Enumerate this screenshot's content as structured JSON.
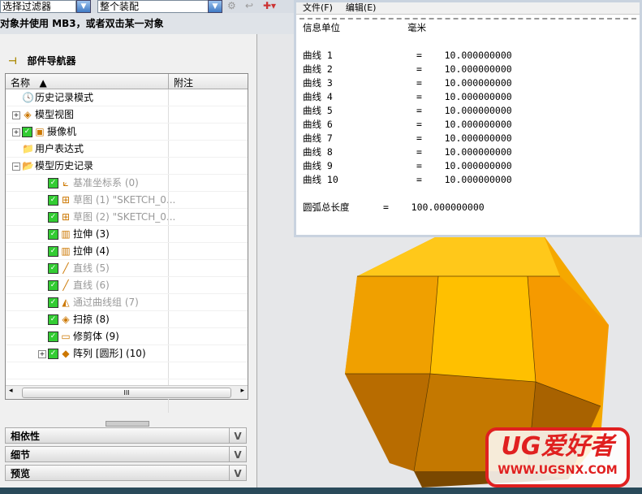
{
  "toolbar": {
    "filter": "选择过滤器",
    "scope": "整个装配"
  },
  "cue": "对象并使用 MB3，或者双击某一对象",
  "navigator": {
    "title": "部件导航器",
    "col_name": "名称",
    "col_note": "附注",
    "items": [
      {
        "label": "历史记录模式",
        "icon": "clock-icon",
        "gray": false,
        "check": false,
        "expand": ""
      },
      {
        "label": "模型视图",
        "icon": "model-views-icon",
        "gray": false,
        "check": false,
        "expand": "+"
      },
      {
        "label": "摄像机",
        "icon": "camera-icon",
        "gray": false,
        "check": true,
        "expand": "+"
      },
      {
        "label": "用户表达式",
        "icon": "folder-icon",
        "gray": false,
        "check": false,
        "expand": ""
      },
      {
        "label": "模型历史记录",
        "icon": "folder-open-icon",
        "gray": false,
        "check": false,
        "expand": "-"
      },
      {
        "label": "基准坐标系 (0)",
        "icon": "datum-csys-icon",
        "gray": true,
        "check": true,
        "expand": ""
      },
      {
        "label": "草图 (1) \"SKETCH_0...",
        "icon": "sketch-icon",
        "gray": true,
        "check": true,
        "expand": ""
      },
      {
        "label": "草图 (2) \"SKETCH_0...",
        "icon": "sketch-icon",
        "gray": true,
        "check": true,
        "expand": ""
      },
      {
        "label": "拉伸 (3)",
        "icon": "extrude-icon",
        "gray": false,
        "check": true,
        "expand": ""
      },
      {
        "label": "拉伸 (4)",
        "icon": "extrude-icon",
        "gray": false,
        "check": true,
        "expand": ""
      },
      {
        "label": "直线 (5)",
        "icon": "line-icon",
        "gray": true,
        "check": true,
        "expand": ""
      },
      {
        "label": "直线 (6)",
        "icon": "line-icon",
        "gray": true,
        "check": true,
        "expand": ""
      },
      {
        "label": "通过曲线组 (7)",
        "icon": "through-curves-icon",
        "gray": true,
        "check": true,
        "expand": ""
      },
      {
        "label": "扫掠 (8)",
        "icon": "swept-icon",
        "gray": false,
        "check": true,
        "expand": ""
      },
      {
        "label": "修剪体 (9)",
        "icon": "trim-body-icon",
        "gray": false,
        "check": true,
        "expand": ""
      },
      {
        "label": "阵列 [圆形] (10)",
        "icon": "pattern-icon",
        "gray": false,
        "check": true,
        "expand": "+"
      }
    ]
  },
  "panels": [
    "相依性",
    "细节",
    "预览"
  ],
  "info": {
    "menu": [
      "文件(F)",
      "编辑(E)"
    ],
    "unit_label": "信息单位",
    "unit": "毫米",
    "curves": [
      [
        "曲线 1",
        "10.000000000"
      ],
      [
        "曲线 2",
        "10.000000000"
      ],
      [
        "曲线 3",
        "10.000000000"
      ],
      [
        "曲线 4",
        "10.000000000"
      ],
      [
        "曲线 5",
        "10.000000000"
      ],
      [
        "曲线 6",
        "10.000000000"
      ],
      [
        "曲线 7",
        "10.000000000"
      ],
      [
        "曲线 8",
        "10.000000000"
      ],
      [
        "曲线 9",
        "10.000000000"
      ],
      [
        "曲线 10",
        "10.000000000"
      ]
    ],
    "total_label": "圆弧总长度",
    "total": "100.000000000"
  },
  "watermark": {
    "title": "UG爱好者",
    "url": "WWW.UGSNX.COM"
  }
}
